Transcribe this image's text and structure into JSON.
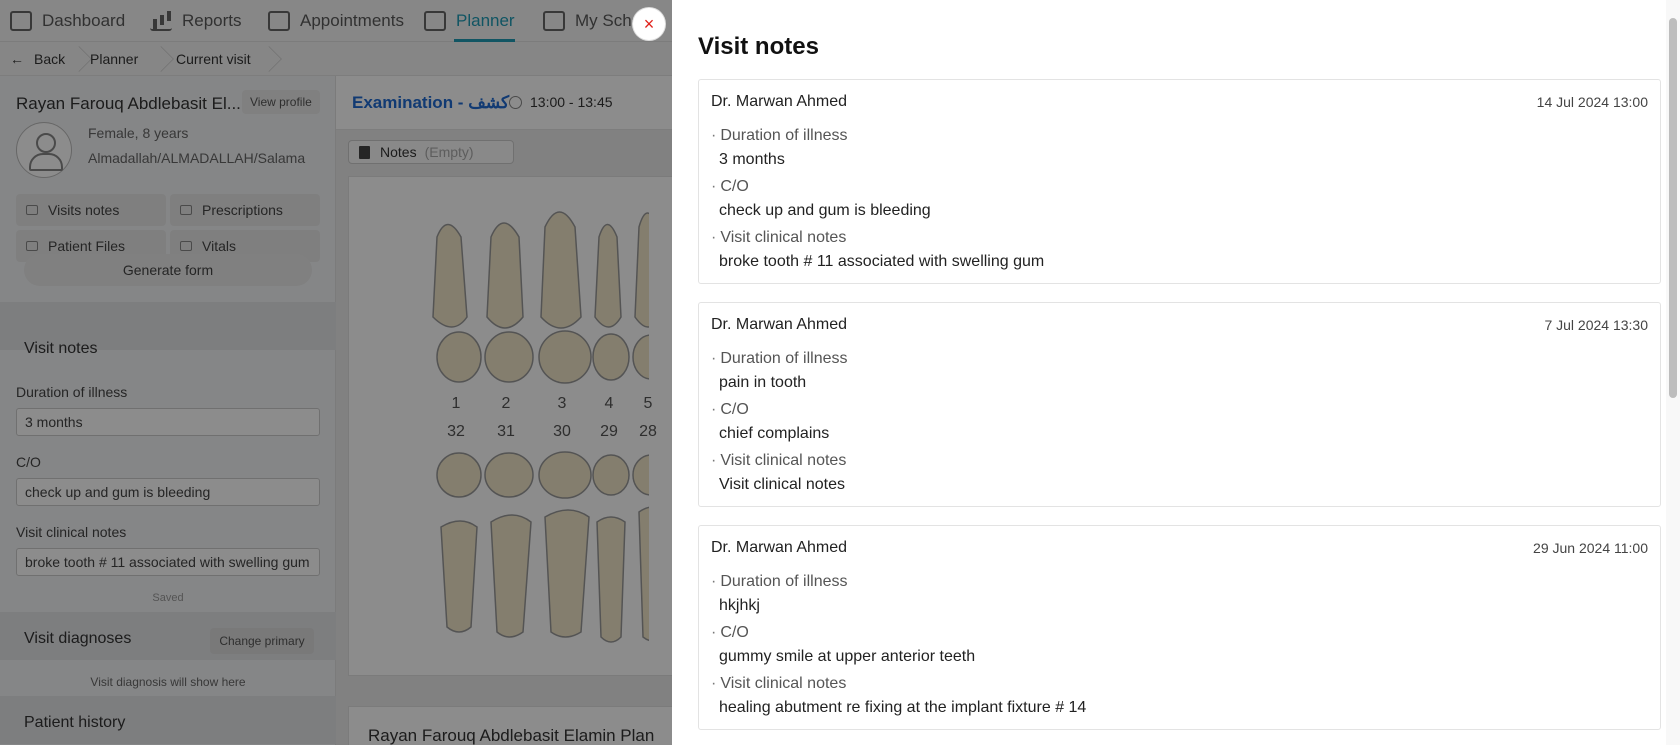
{
  "nav": {
    "items": [
      {
        "label": "Dashboard"
      },
      {
        "label": "Reports"
      },
      {
        "label": "Appointments"
      },
      {
        "label": "Planner"
      },
      {
        "label": "My Sche"
      }
    ]
  },
  "breadcrumb": {
    "back": "Back",
    "items": [
      "Planner",
      "Current visit"
    ]
  },
  "patient": {
    "name": "Rayan Farouq Abdlebasit El...",
    "view_profile": "View profile",
    "gender_age": "Female, 8 years",
    "location": "Almadallah/ALMADALLAH/Salama"
  },
  "sidebar": {
    "buttons": [
      "Visits notes",
      "Prescriptions",
      "Patient Files",
      "Vitals"
    ],
    "generate_form": "Generate form",
    "visit_notes_title": "Visit notes",
    "fields": [
      {
        "label": "Duration of illness",
        "value": "3 months"
      },
      {
        "label": "C/O",
        "value": "check up and gum is bleeding"
      },
      {
        "label": "Visit clinical notes",
        "value": "broke tooth # 11 associated with swelling gum"
      }
    ],
    "saved": "Saved",
    "diagnoses_title": "Visit diagnoses",
    "change_primary": "Change primary",
    "diagnosis_empty": "Visit diagnosis will show here",
    "history_title": "Patient history"
  },
  "content": {
    "exam_title": "Examination - كشف",
    "time": "13:00 - 13:45",
    "notes_label": "Notes",
    "notes_empty": "(Empty)",
    "upper_numbers": [
      "1",
      "2",
      "3",
      "4",
      "5"
    ],
    "lower_numbers": [
      "32",
      "31",
      "30",
      "29",
      "28"
    ],
    "plan_title": "Rayan Farouq Abdlebasit Elamin Plan"
  },
  "drawer": {
    "title": "Visit notes",
    "close_symbol": "×",
    "notes": [
      {
        "doctor": "Dr. Marwan Ahmed",
        "date": "14 Jul 2024 13:00",
        "fields": [
          {
            "label": "Duration of illness",
            "value": "3 months"
          },
          {
            "label": "C/O",
            "value": "check up and gum is bleeding"
          },
          {
            "label": "Visit clinical notes",
            "value": "broke tooth # 11 associated with swelling gum"
          }
        ]
      },
      {
        "doctor": "Dr. Marwan Ahmed",
        "date": "7 Jul 2024 13:30",
        "fields": [
          {
            "label": "Duration of illness",
            "value": "pain in tooth"
          },
          {
            "label": "C/O",
            "value": "chief complains"
          },
          {
            "label": "Visit clinical notes",
            "value": "Visit clinical notes"
          }
        ]
      },
      {
        "doctor": "Dr. Marwan Ahmed",
        "date": "29 Jun 2024 11:00",
        "fields": [
          {
            "label": "Duration of illness",
            "value": "hkjhkj"
          },
          {
            "label": "C/O",
            "value": "gummy smile at upper anterior teeth"
          },
          {
            "label": "Visit clinical notes",
            "value": "healing abutment re fixing at the implant fixture # 14"
          }
        ]
      }
    ]
  },
  "colors": {
    "accent": "#1f9bb5",
    "exam_title": "#1f6bd1",
    "close": "#e0211a",
    "overlay": "rgba(0,0,0,0.45)"
  }
}
